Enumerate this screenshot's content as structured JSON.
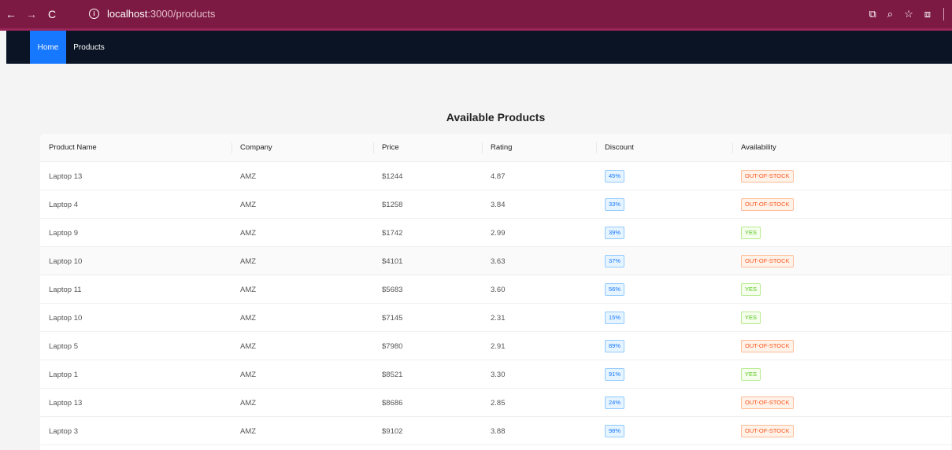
{
  "browser": {
    "url_host": "localhost",
    "url_path": ":3000/products",
    "back_icon": "←",
    "forward_icon": "→",
    "reload_icon": "C",
    "info_icon": "i",
    "cast_icon": "⧉",
    "zoom_icon": "⌕",
    "star_icon": "☆",
    "extensions_icon": "⧈"
  },
  "nav": {
    "home": "Home",
    "products": "Products"
  },
  "page_title": "Available Products",
  "table": {
    "headers": [
      "Product Name",
      "Company",
      "Price",
      "Rating",
      "Discount",
      "Availability"
    ],
    "rows": [
      {
        "name": "Laptop 13",
        "company": "AMZ",
        "price": "$1244",
        "rating": "4.87",
        "discount": "45%",
        "availability": "OUT-OF-STOCK"
      },
      {
        "name": "Laptop 4",
        "company": "AMZ",
        "price": "$1258",
        "rating": "3.84",
        "discount": "33%",
        "availability": "OUT-OF-STOCK"
      },
      {
        "name": "Laptop 9",
        "company": "AMZ",
        "price": "$1742",
        "rating": "2.99",
        "discount": "39%",
        "availability": "YES"
      },
      {
        "name": "Laptop 10",
        "company": "AMZ",
        "price": "$4101",
        "rating": "3.63",
        "discount": "37%",
        "availability": "OUT-OF-STOCK"
      },
      {
        "name": "Laptop 11",
        "company": "AMZ",
        "price": "$5683",
        "rating": "3.60",
        "discount": "56%",
        "availability": "YES"
      },
      {
        "name": "Laptop 10",
        "company": "AMZ",
        "price": "$7145",
        "rating": "2.31",
        "discount": "15%",
        "availability": "YES"
      },
      {
        "name": "Laptop 5",
        "company": "AMZ",
        "price": "$7980",
        "rating": "2.91",
        "discount": "89%",
        "availability": "OUT-OF-STOCK"
      },
      {
        "name": "Laptop 1",
        "company": "AMZ",
        "price": "$8521",
        "rating": "3.30",
        "discount": "91%",
        "availability": "YES"
      },
      {
        "name": "Laptop 13",
        "company": "AMZ",
        "price": "$8686",
        "rating": "2.85",
        "discount": "24%",
        "availability": "OUT-OF-STOCK"
      },
      {
        "name": "Laptop 3",
        "company": "AMZ",
        "price": "$9102",
        "rating": "3.88",
        "discount": "98%",
        "availability": "OUT-OF-STOCK"
      }
    ]
  },
  "colors": {
    "browser_bar": "#7d1a43",
    "navbar": "#0b1424",
    "nav_active": "#1677ff"
  }
}
